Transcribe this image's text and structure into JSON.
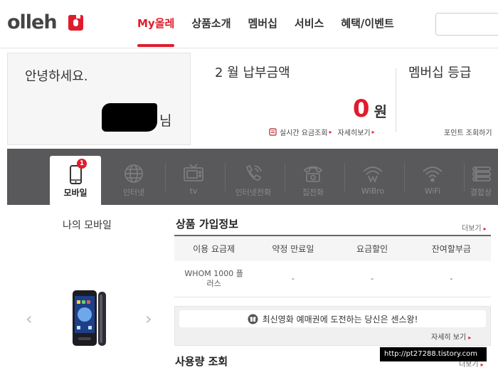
{
  "header": {
    "logo_text": "olleh",
    "nav": [
      "My올레",
      "상품소개",
      "멤버십",
      "서비스",
      "혜택/이벤트"
    ],
    "active_nav": "My올레",
    "search_placeholder": ""
  },
  "summary": {
    "greeting": "안녕하세요.",
    "name_suffix": "님",
    "bill_title": "2 월 납부금액",
    "bill_amount": "0",
    "bill_unit": "원",
    "realtime_link": "실시간 요금조회",
    "detail_link": "자세히보기",
    "membership_title": "멤버십 등급",
    "points_link": "포인트 조회하기"
  },
  "service_tabs": [
    {
      "label": "모바일",
      "icon": "mobile-phone-icon",
      "badge": "1",
      "active": true
    },
    {
      "label": "인터넷",
      "icon": "globe-icon"
    },
    {
      "label": "tv",
      "icon": "tv-icon"
    },
    {
      "label": "인터넷전화",
      "icon": "internet-phone-icon"
    },
    {
      "label": "집전화",
      "icon": "home-phone-icon"
    },
    {
      "label": "WiBro",
      "icon": "wibro-icon"
    },
    {
      "label": "WiFi",
      "icon": "wifi-icon"
    },
    {
      "label": "결합상",
      "icon": "bundle-icon"
    }
  ],
  "my_mobile": {
    "title": "나의 모바일",
    "prev": "‹",
    "next": "›"
  },
  "product_info": {
    "title": "상품 가입정보",
    "more": "더보기",
    "columns": [
      "이용 요금제",
      "약정 만료일",
      "요금할인",
      "잔여할부금"
    ],
    "rows": [
      [
        "WHOM 1000 플러스",
        "-",
        "-",
        "-"
      ]
    ]
  },
  "promo": {
    "text": "최신영화 예매권에 도전하는 당신은 센스왕!",
    "more": "자세히 보기"
  },
  "usage": {
    "title": "사용량 조회",
    "more": "더보기"
  },
  "watermark": "http://pt27288.tistory.com",
  "colors": {
    "brand_red": "#e01c2c",
    "tab_bar": "#59595b"
  }
}
